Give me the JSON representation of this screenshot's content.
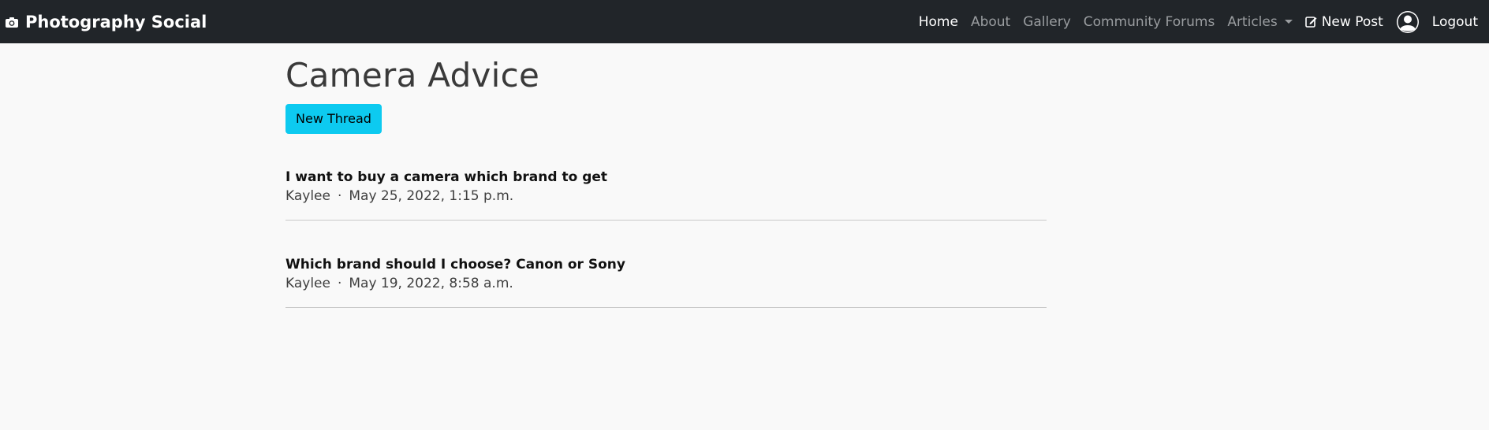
{
  "navbar": {
    "brand": "Photography Social",
    "brand_icon": "camera-icon",
    "links": {
      "home": "Home",
      "about": "About",
      "gallery": "Gallery",
      "forums": "Community Forums",
      "articles": "Articles",
      "new_post": "New Post",
      "logout": "Logout"
    },
    "new_post_icon": "edit-icon",
    "avatar_icon": "user-circle-icon"
  },
  "main": {
    "title": "Camera Advice",
    "new_thread_label": "New Thread",
    "threads": [
      {
        "title": "I want to buy a camera which brand to get",
        "author": "Kaylee",
        "separator": "·",
        "date": "May 25, 2022, 1:15 p.m."
      },
      {
        "title": "Which brand should I choose? Canon or Sony",
        "author": "Kaylee",
        "separator": "·",
        "date": "May 19, 2022, 8:58 a.m."
      }
    ]
  },
  "colors": {
    "navbar_bg": "#212529",
    "page_bg": "#f9f9f9",
    "button_bg": "#0dcaf0",
    "nav_muted": "#9a9da0"
  }
}
